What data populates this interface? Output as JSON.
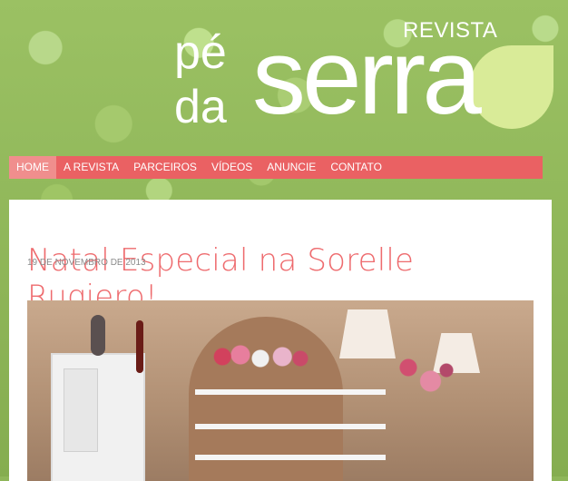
{
  "header": {
    "logo": {
      "revista": "REVISTA",
      "pe": "pé",
      "da": "da",
      "serra": "serra"
    }
  },
  "nav": {
    "items": [
      {
        "label": "HOME",
        "active": true
      },
      {
        "label": "A REVISTA",
        "active": false
      },
      {
        "label": "PARCEIROS",
        "active": false
      },
      {
        "label": "VÍDEOS",
        "active": false
      },
      {
        "label": "ANUNCIE",
        "active": false
      },
      {
        "label": "CONTATO",
        "active": false
      }
    ]
  },
  "post": {
    "title": "Natal Especial na Sorelle Rugiero!",
    "date": "19 DE NOVEMBRO DE 2013"
  },
  "colors": {
    "background": "#8fb65a",
    "nav": "#ea6163",
    "nav_active": "#f08e8d",
    "title": "#ee6b6e",
    "logo_accent": "#d9eb98"
  }
}
